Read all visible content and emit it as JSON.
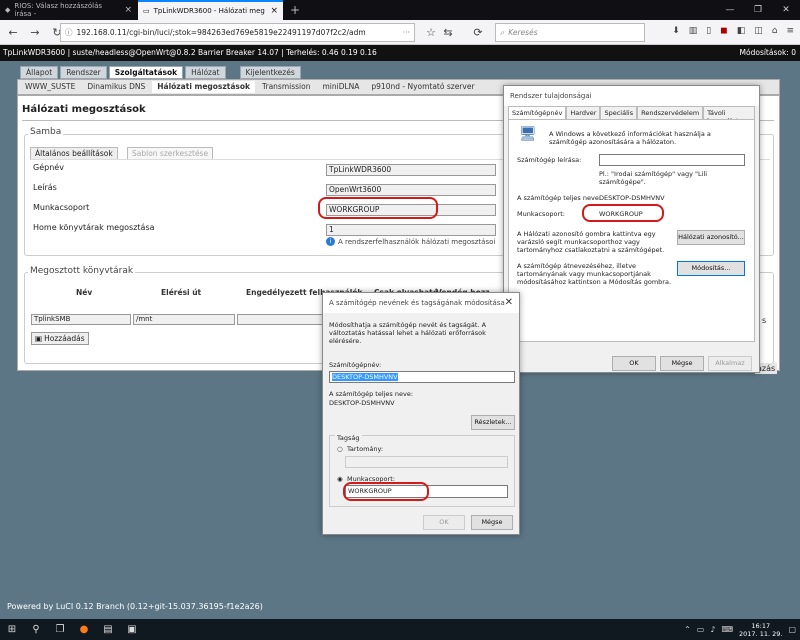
{
  "browser": {
    "tabs": [
      {
        "label": "RIOS: Válasz hozzászólás írása -"
      },
      {
        "label": "TpLinkWDR3600 - Hálózati meg"
      }
    ],
    "url": "192.168.0.11/cgi-bin/luci/;stok=984263ed769e5819e22491197d07f2c2/adm",
    "search_placeholder": "Keresés"
  },
  "status": {
    "left": "TpLinkWDR3600 | suste/headless@OpenWrt@0.8.2 Barrier Breaker 14.07 | Terhelés: 0.46 0.19 0.16",
    "right": "Módosítások: 0"
  },
  "luci": {
    "main_tabs": [
      "Állapot",
      "Rendszer",
      "Szolgáltatások",
      "Hálózat",
      "Kijelentkezés"
    ],
    "sub_tabs": [
      "WWW_SUSTE",
      "Dinamikus DNS",
      "Hálózati megosztások",
      "Transmission",
      "miniDLNA",
      "p910nd - Nyomtató szerver"
    ],
    "page_title": "Hálózati megosztások",
    "samba_legend": "Samba",
    "form_tabs": [
      "Általános beállítások",
      "Sablon szerkesztése"
    ],
    "fields": [
      {
        "label": "Gépnév",
        "value": "TpLinkWDR3600"
      },
      {
        "label": "Leírás",
        "value": "OpenWrt3600"
      },
      {
        "label": "Munkacsoport",
        "value": "WORKGROUP"
      },
      {
        "label": "Home könyvtárak megosztása",
        "value": "1"
      }
    ],
    "home_hint": "A rendszerfelhasználók hálózati megosztásoi",
    "shares_legend": "Megosztott könyvtárak",
    "table_headers": [
      "Név",
      "Elérési út",
      "Engedélyezett felhasználók",
      "Csak olvasható",
      "Vendég hozz"
    ],
    "table_row": [
      "TplinkSMB",
      "/mnt"
    ],
    "add_label": "Hozzáadás",
    "save_label": "azás",
    "footer": "Powered by LuCI 0.12 Branch (0.12+git-15.037.36195-f1e2a26)"
  },
  "sysprops": {
    "title": "Rendszer tulajdonságai",
    "tabs": [
      "Számítógépnév",
      "Hardver",
      "Speciális",
      "Rendszervédelem",
      "Távoli használat"
    ],
    "intro": "A Windows a következő információkat használja a számítógép azonosítására a hálózaton.",
    "desc_label": "Számítógép leírása:",
    "desc_hint": "Pl.: \"Irodai számítógép\" vagy \"Lili számítógépe\".",
    "fullname_label": "A számítógép teljes neve:",
    "fullname_value": "DESKTOP-DSMHVNV",
    "workgroup_label": "Munkacsoport:",
    "workgroup_value": "WORKGROUP",
    "network_id_text": "A Hálózati azonosító gombra kattintva egy varázsló segít munkacsoporthoz vagy tartományhoz csatlakoztatni a számítógépet.",
    "network_id_btn": "Hálózati azonosító...",
    "rename_text": "A számítógép átnevezéséhez, illetve tartományának vagy munkacsoportjának módosításához kattintson a Módosítás gombra.",
    "change_btn": "Módosítás...",
    "ok": "OK",
    "cancel": "Mégse",
    "apply": "Alkalmaz"
  },
  "rename": {
    "title": "A számítógép nevének és tagságának módosítása",
    "intro": "Módosíthatja a számítógép nevét és tagságát. A változtatás hatással lehet a hálózati erőforrások elérésére.",
    "name_label": "Számítógépnév:",
    "name_value": "DESKTOP-DSMHVNV",
    "fullname_label": "A számítógép teljes neve:",
    "fullname_value": "DESKTOP-DSMHVNV",
    "details_btn": "Részletek...",
    "member_label": "Tagság",
    "domain_label": "Tartomány:",
    "workgroup_label": "Munkacsoport:",
    "workgroup_value": "WORKGROUP",
    "ok": "OK",
    "cancel": "Mégse"
  },
  "taskbar": {
    "time": "16:17",
    "date": "2017. 11. 29."
  },
  "colors": {
    "highlight": "#d21a1a",
    "luci_bg": "#5c7686",
    "accent": "#0a84ff"
  }
}
